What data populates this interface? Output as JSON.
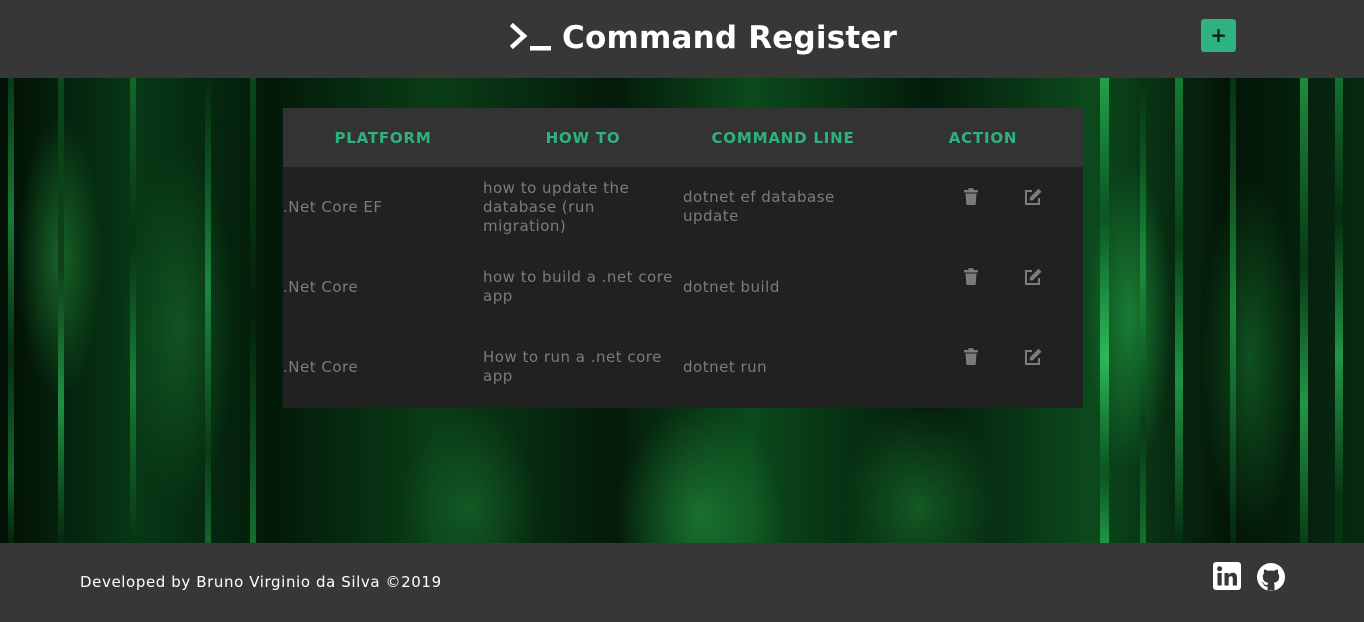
{
  "header": {
    "title": "Command Register",
    "add_label": "+"
  },
  "table": {
    "headers": [
      "PLATFORM",
      "HOW TO",
      "COMMAND LINE",
      "ACTION"
    ],
    "rows": [
      {
        "platform": ".Net Core EF",
        "how_to": "how to update the database (run migration)",
        "command": "dotnet ef database update"
      },
      {
        "platform": ".Net Core",
        "how_to": "how to build a .net core app",
        "command": "dotnet build"
      },
      {
        "platform": ".Net Core",
        "how_to": "How to run a .net core app",
        "command": "dotnet run"
      }
    ]
  },
  "footer": {
    "credit": "Developed by Bruno Virginio da Silva ©2019"
  },
  "icons": {
    "brand": "terminal-prompt-icon",
    "delete": "trash-icon",
    "edit": "edit-icon",
    "linkedin": "linkedin-icon",
    "github": "github-icon"
  },
  "colors": {
    "accent": "#2fb37e",
    "header_bg": "#373737",
    "table_bg": "#212121",
    "table_head_bg": "#333333"
  }
}
